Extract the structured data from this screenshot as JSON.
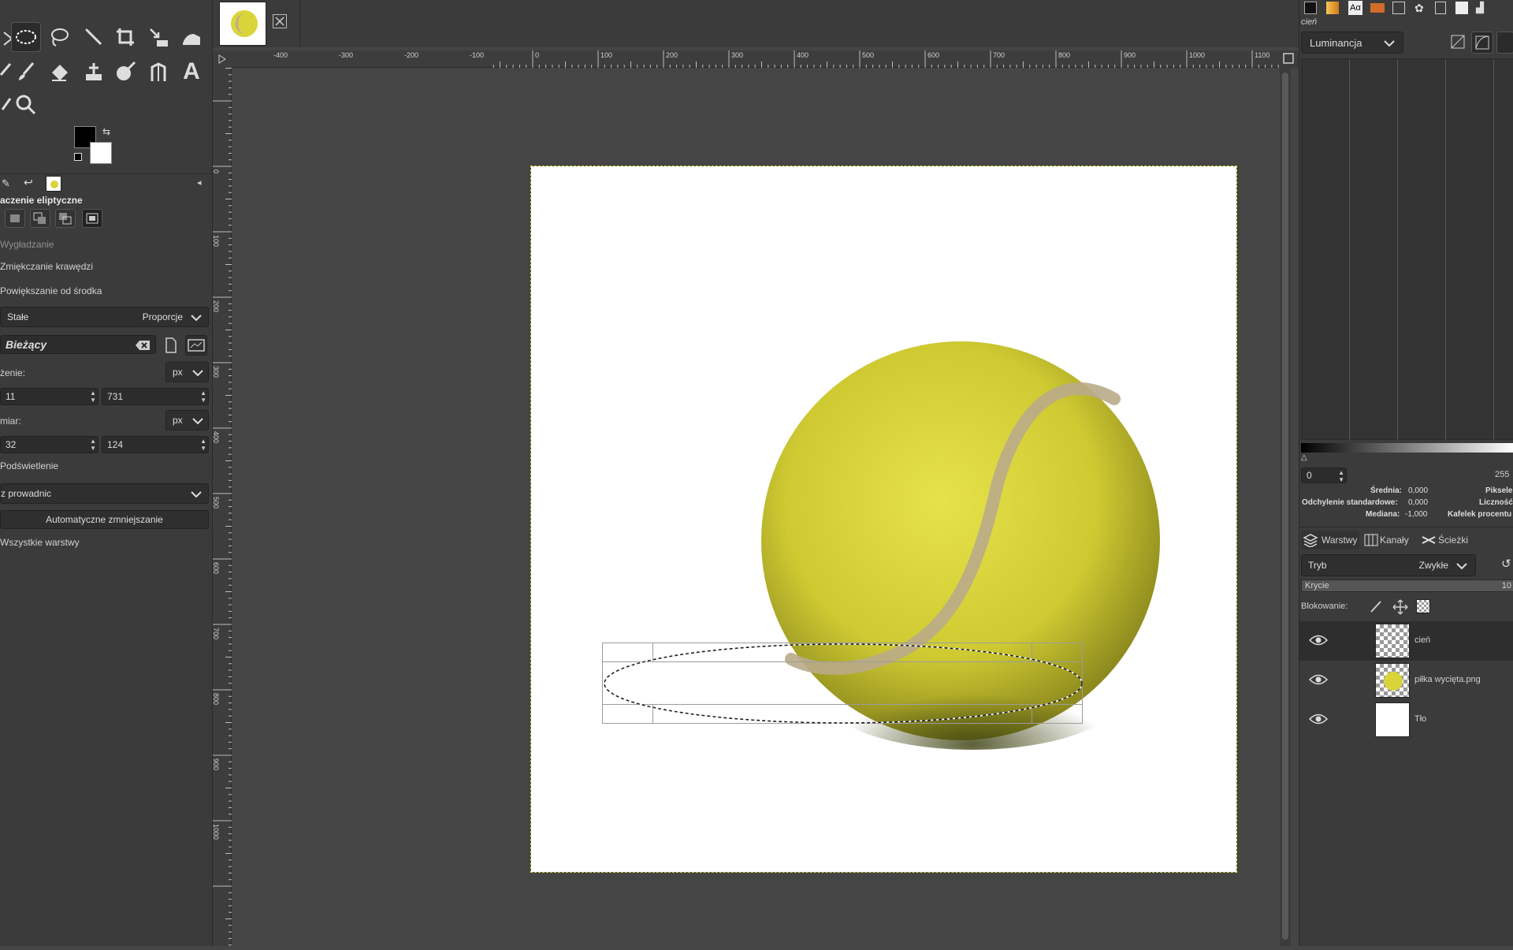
{
  "toolbox": {
    "tools": [
      "free-select-icon",
      "ellipse-select-icon",
      "lasso-icon",
      "fuzzy-select-icon",
      "crop-icon",
      "transform-icon",
      "bucket-fill-icon",
      "paintbrush-icon",
      "eraser-icon",
      "clone-icon",
      "dodge-burn-icon",
      "path-icon",
      "text-icon",
      "color-picker-icon",
      "zoom-icon"
    ],
    "text_tool_glyph": "A"
  },
  "tool_options": {
    "title": "aczenie eliptyczne",
    "antialias_label": "Wygładzanie",
    "feather_label": "Zmiękczanie krawędzi",
    "expand_center_label": "Powiększanie od środka",
    "fixed_label": "Stałe",
    "fixed_value": "Proporcje",
    "current_value": "Bieżący",
    "position_label": "żenie:",
    "position_unit": "px",
    "position_x": "11",
    "position_y": "731",
    "size_label": "miar:",
    "size_unit": "px",
    "size_w": "32",
    "size_h": "124",
    "highlight_label": "Podświetlenie",
    "guides_value": "z prowadnic",
    "auto_shrink_label": "Automatyczne zmniejszanie",
    "all_layers_label": "Wszystkie warstwy"
  },
  "ruler": {
    "h_labels": [
      "-400",
      "-300",
      "-200",
      "-100",
      "0",
      "100",
      "200",
      "300",
      "400",
      "500",
      "600",
      "700",
      "800",
      "900",
      "1000",
      "1100"
    ],
    "v_labels": [
      "0",
      "100",
      "200",
      "300",
      "400",
      "500",
      "600",
      "700",
      "800",
      "900",
      "1000"
    ]
  },
  "histogram": {
    "layer_name": "cień",
    "channel": "Luminancja",
    "range_min": "0",
    "range_max": "255",
    "mean_label": "Średnia:",
    "mean_value": "0,000",
    "std_label": "Odchylenie standardowe:",
    "std_value": "0,000",
    "median_label": "Mediana:",
    "median_value": "-1,000",
    "pixels_label": "Piksele",
    "count_label": "Liczność",
    "percentile_label": "Kafelek procentu"
  },
  "layers_panel": {
    "tabs": [
      "Warstwy",
      "Kanały",
      "Ścieżki"
    ],
    "mode_label": "Tryb",
    "mode_value": "Zwykłe",
    "opacity_label": "Krycie",
    "opacity_value": "10",
    "lock_label": "Blokowanie:",
    "layers": [
      {
        "name": "cień",
        "active": true
      },
      {
        "name": "piłka wycięta.png",
        "active": false
      },
      {
        "name": "Tło",
        "active": false
      }
    ]
  },
  "colors": {
    "ball": "#d8d43a",
    "seam": "#b9ab8a",
    "selection": "#222222"
  }
}
